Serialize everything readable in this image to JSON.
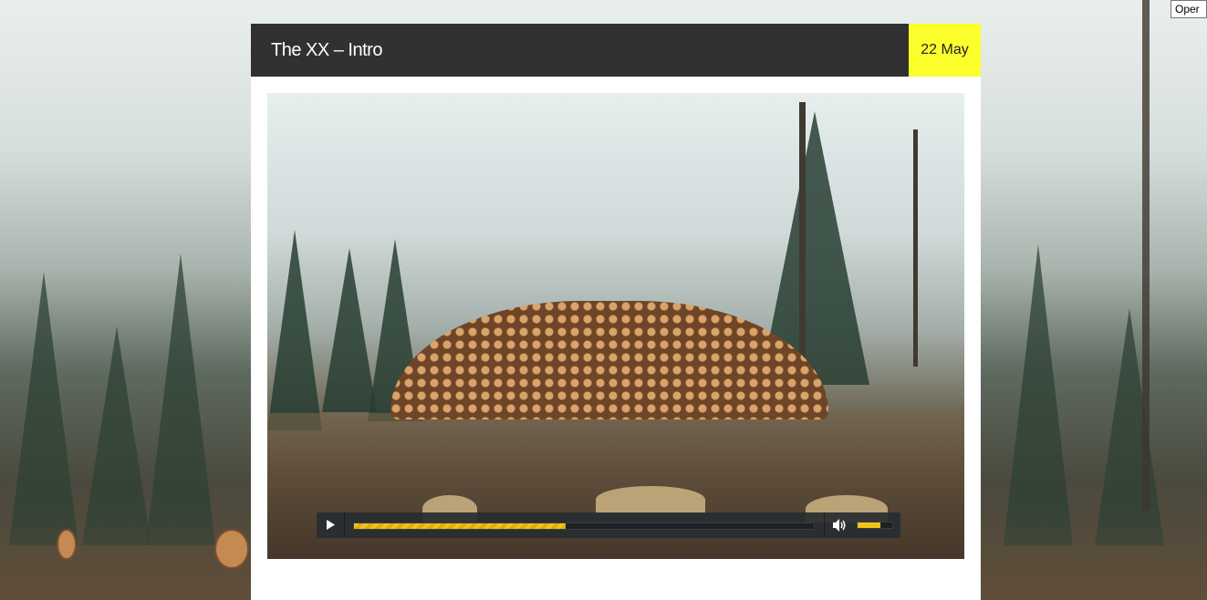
{
  "tooltip": {
    "text": "Oper"
  },
  "post": {
    "title": "The XX – Intro",
    "date": "22 May"
  },
  "player": {
    "progress_percent": 46,
    "volume_percent": 65,
    "accent_color": "#f2c31a",
    "icons": {
      "play": "play-icon",
      "volume": "volume-icon"
    }
  },
  "colors": {
    "header_bg": "#313131",
    "date_badge_bg": "#fbff2b"
  }
}
